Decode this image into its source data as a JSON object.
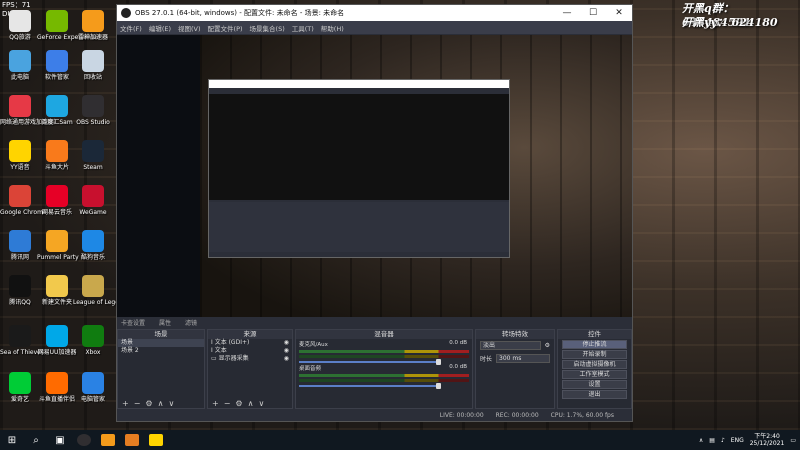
{
  "overlay": {
    "fps_label": "FPS：71",
    "fps_sub": "DUX11",
    "qq_group_line": "开黑q群： 643484591",
    "yy_line": "开黑yy： 624180"
  },
  "desktop_icons": [
    {
      "label": "QQ旅游",
      "color": "#e6e6e6"
    },
    {
      "label": "GeForce Experience",
      "color": "#76b900"
    },
    {
      "label": "雷神加速器",
      "color": "#f59b1b"
    },
    {
      "label": "此电脑",
      "color": "#4aa3df"
    },
    {
      "label": "软件管家",
      "color": "#3d7ee8"
    },
    {
      "label": "回收站",
      "color": "#c9d6e3"
    },
    {
      "label": "网络通用游戏加速器",
      "color": "#e63946"
    },
    {
      "label": "百度汇Sam",
      "color": "#1ea7e1"
    },
    {
      "label": "OBS Studio",
      "color": "#302e31"
    },
    {
      "label": "YY语音",
      "color": "#ffd400"
    },
    {
      "label": "斗鱼大片",
      "color": "#f97a1b"
    },
    {
      "label": "Steam",
      "color": "#1b2838"
    },
    {
      "label": "Google Chrome",
      "color": "#db4437"
    },
    {
      "label": "网易云音乐",
      "color": "#e60026"
    },
    {
      "label": "WeGame",
      "color": "#c8102e"
    },
    {
      "label": "腾讯网",
      "color": "#2e7bd6"
    },
    {
      "label": "Pummel Party",
      "color": "#f5a623"
    },
    {
      "label": "酷狗音乐",
      "color": "#1e88e5"
    },
    {
      "label": "腾讯QQ",
      "color": "#111111"
    },
    {
      "label": "新建文件夹",
      "color": "#f2c94c"
    },
    {
      "label": "League of Legends",
      "color": "#c9a84c"
    },
    {
      "label": "Sea of Thieves",
      "color": "#1a1a1a"
    },
    {
      "label": "网易UU加速器",
      "color": "#00a8e8"
    },
    {
      "label": "Xbox",
      "color": "#107c10"
    },
    {
      "label": "爱奇艺",
      "color": "#00cc36"
    },
    {
      "label": "斗鱼直播伴侣",
      "color": "#ff6b00"
    },
    {
      "label": "电脑管家",
      "color": "#2a82e4"
    }
  ],
  "obs": {
    "title": "OBS 27.0.1 (64-bit, windows) - 配置文件: 未命名 - 场景: 未命名",
    "menu": [
      "文件(F)",
      "编辑(E)",
      "视图(V)",
      "配置文件(P)",
      "场景集合(S)",
      "工具(T)",
      "帮助(H)"
    ],
    "dock_tabs": [
      "卡查设置",
      "属性",
      "滤镜"
    ],
    "scenes": {
      "header": "场景",
      "items": [
        {
          "label": "场景",
          "selected": true
        },
        {
          "label": "场景 2",
          "selected": false
        }
      ]
    },
    "sources": {
      "header": "来源",
      "items": [
        {
          "label": "文本 (GDI+)"
        },
        {
          "label": "文本"
        },
        {
          "label": "显示器采集"
        }
      ]
    },
    "mixer": {
      "header": "混音器",
      "tracks": [
        {
          "name": "麦克风/Aux",
          "db": "0.0 dB"
        },
        {
          "name": "桌面音频",
          "db": "0.0 dB"
        }
      ]
    },
    "transitions": {
      "header": "转场特效",
      "type": "淡出",
      "duration_label": "时长",
      "duration_value": "300 ms"
    },
    "controls": {
      "header": "控件",
      "buttons": [
        {
          "label": "停止推流",
          "active": true
        },
        {
          "label": "开始录制",
          "active": false
        },
        {
          "label": "启动虚拟摄像机",
          "active": false
        },
        {
          "label": "工作室模式",
          "active": false
        },
        {
          "label": "设置",
          "active": false
        },
        {
          "label": "退出",
          "active": false
        }
      ]
    },
    "status": {
      "live": "LIVE: 00:00:00",
      "rec": "REC: 00:00:00",
      "cpu": "CPU: 1.7%, 60.00 fps"
    }
  },
  "taskbar": {
    "lang": "ENG",
    "time": "下午2:40",
    "date": "25/12/2021"
  }
}
